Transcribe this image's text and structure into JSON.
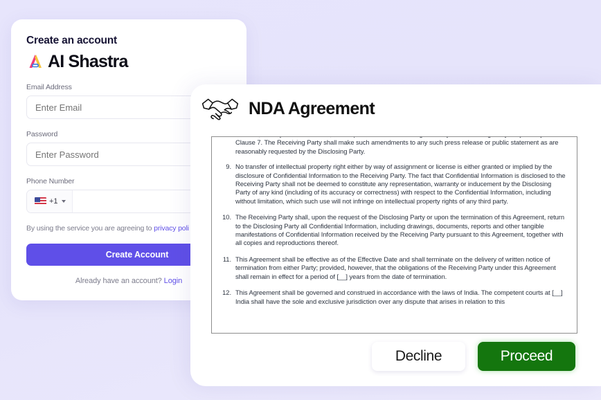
{
  "colors": {
    "page_background": "#e6e4fb",
    "primary_purple": "#5f4fe8",
    "proceed_green": "#14760e",
    "logo_pink": "#ef3b7d",
    "logo_yellow": "#f8c43a",
    "logo_blue": "#3b7ddd"
  },
  "signup": {
    "title": "Create an account",
    "brand_name": "AI Shastra",
    "email": {
      "label": "Email Address",
      "placeholder": "Enter Email",
      "value": ""
    },
    "password": {
      "label": "Password",
      "placeholder": "Enter Password",
      "value": ""
    },
    "phone": {
      "label": "Phone Number",
      "country_code": "+1",
      "country_flag": "us-flag-icon",
      "placeholder": "",
      "value": ""
    },
    "terms_text": "By using the service you are agreeing to ",
    "terms_link": "privacy poli",
    "create_account_label": "Create Account",
    "login_prompt": "Already have an account? ",
    "login_link": "Login"
  },
  "nda": {
    "icon": "handshake-icon",
    "title": "NDA Agreement",
    "lead_paragraph": "affiliates, or subject matter hereof, unless prior written consent is granted by the Disclosing Party subject only to Clause 7. The Receiving Party shall make such amendments to any such press release or public statement as are reasonably requested by the Disclosing Party.",
    "clauses": [
      {
        "number": "9.",
        "text": "No transfer of intellectual property right either by way of assignment or license is either granted or implied by the disclosure of Confidential Information to the Receiving Party. The fact that Confidential Information is disclosed to the Receiving Party shall not be deemed to constitute any representation, warranty or inducement by the Disclosing Party of any kind (including of its accuracy or correctness) with respect to the Confidential Information, including without limitation, which such use will not infringe on intellectual property rights of any third party."
      },
      {
        "number": "10.",
        "text": "The Receiving Party shall, upon the request of the Disclosing Party or upon the termination of this Agreement, return to the Disclosing Party all Confidential Information, including drawings, documents, reports and other tangible manifestations of Confidential Information received by the Receiving Party pursuant to this Agreement, together with all copies and reproductions thereof."
      },
      {
        "number": "11.",
        "text": "This Agreement shall be effective as of the Effective Date and shall terminate on the delivery of written notice of termination from either Party; provided, however, that the obligations of the Receiving Party under this Agreement shall remain in effect for a period of [__] years from the date of termination."
      },
      {
        "number": "12.",
        "text": "This Agreement shall be governed and construed in accordance with the laws of India. The competent courts at [__] India shall have the sole and exclusive jurisdiction over any dispute that arises in relation to this"
      }
    ],
    "decline_label": "Decline",
    "proceed_label": "Proceed"
  }
}
